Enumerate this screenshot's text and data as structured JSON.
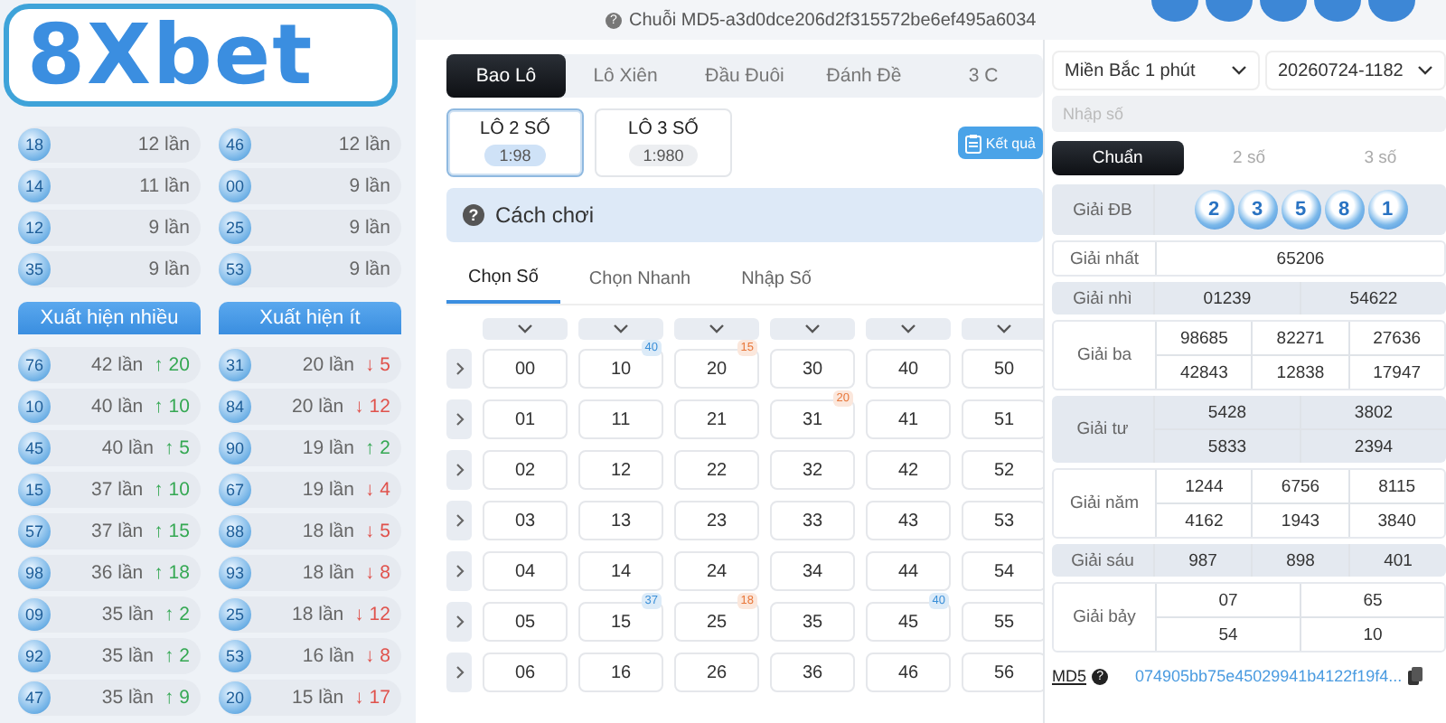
{
  "logo": {
    "text": "8Xbet"
  },
  "stats": {
    "columns": [
      {
        "rows": [
          {
            "ball": "18",
            "count": "12 lần"
          },
          {
            "ball": "14",
            "count": "11 lần"
          },
          {
            "ball": "12",
            "count": "9 lần"
          },
          {
            "ball": "35",
            "count": "9 lần"
          }
        ]
      },
      {
        "rows": [
          {
            "ball": "46",
            "count": "12 lần"
          },
          {
            "ball": "00",
            "count": "9 lần"
          },
          {
            "ball": "25",
            "count": "9 lần"
          },
          {
            "ball": "53",
            "count": "9 lần"
          }
        ]
      }
    ]
  },
  "frequency": [
    {
      "title": "Xuất hiện nhiều",
      "rows": [
        {
          "ball": "76",
          "count": "42 lần",
          "trend": "↑ 20",
          "rising": true
        },
        {
          "ball": "10",
          "count": "40 lần",
          "trend": "↑ 10",
          "rising": true
        },
        {
          "ball": "45",
          "count": "40 lần",
          "trend": "↑ 5",
          "rising": true
        },
        {
          "ball": "15",
          "count": "37 lần",
          "trend": "↑ 10",
          "rising": true
        },
        {
          "ball": "57",
          "count": "37 lần",
          "trend": "↑ 15",
          "rising": true
        },
        {
          "ball": "98",
          "count": "36 lần",
          "trend": "↑ 18",
          "rising": true
        },
        {
          "ball": "09",
          "count": "35 lần",
          "trend": "↑ 2",
          "rising": true
        },
        {
          "ball": "92",
          "count": "35 lần",
          "trend": "↑ 2",
          "rising": true
        },
        {
          "ball": "47",
          "count": "35 lần",
          "trend": "↑ 9",
          "rising": true
        }
      ]
    },
    {
      "title": "Xuất hiện ít",
      "rows": [
        {
          "ball": "31",
          "count": "20 lần",
          "trend": "↓ 5",
          "rising": false
        },
        {
          "ball": "84",
          "count": "20 lần",
          "trend": "↓ 12",
          "rising": false
        },
        {
          "ball": "90",
          "count": "19 lần",
          "trend": "↑ 2",
          "rising": true
        },
        {
          "ball": "67",
          "count": "19 lần",
          "trend": "↓ 4",
          "rising": false
        },
        {
          "ball": "88",
          "count": "18 lần",
          "trend": "↓ 5",
          "rising": false
        },
        {
          "ball": "93",
          "count": "18 lần",
          "trend": "↓ 8",
          "rising": false
        },
        {
          "ball": "25",
          "count": "18 lần",
          "trend": "↓ 12",
          "rising": false
        },
        {
          "ball": "53",
          "count": "16 lần",
          "trend": "↓ 8",
          "rising": false
        },
        {
          "ball": "20",
          "count": "15 lần",
          "trend": "↓ 17",
          "rising": false
        }
      ]
    }
  ],
  "md5_chain": {
    "help": "?",
    "text": "Chuỗi MD5-a3d0dce206d2f315572be6ef495a6034"
  },
  "game_tabs": [
    {
      "label": "Bao Lô",
      "selected": true
    },
    {
      "label": "Lô Xiên",
      "selected": false
    },
    {
      "label": "Đầu Đuôi",
      "selected": false
    },
    {
      "label": "Đánh Đề",
      "selected": false
    },
    {
      "label": "3 C",
      "selected": false
    }
  ],
  "bet_types": [
    {
      "name": "LÔ 2 SỐ",
      "odds": "1:98",
      "selected": true
    },
    {
      "name": "LÔ 3 SỐ",
      "odds": "1:980",
      "selected": false
    }
  ],
  "result_button": "Kết quả",
  "how_to_play": {
    "help": "?",
    "text": "Cách chơi"
  },
  "pick_tabs": [
    {
      "label": "Chọn Số",
      "selected": true
    },
    {
      "label": "Chọn Nhanh",
      "selected": false
    },
    {
      "label": "Nhập Số",
      "selected": false
    }
  ],
  "grid": {
    "rows": [
      {
        "cells": [
          {
            "number": "00"
          },
          {
            "number": "10",
            "badge": "40",
            "color": "#3a8fd8"
          },
          {
            "number": "20",
            "badge": "15",
            "color": "#e8773a"
          },
          {
            "number": "30"
          },
          {
            "number": "40"
          },
          {
            "number": "50"
          }
        ]
      },
      {
        "cells": [
          {
            "number": "01"
          },
          {
            "number": "11"
          },
          {
            "number": "21"
          },
          {
            "number": "31",
            "badge": "20",
            "color": "#e8773a"
          },
          {
            "number": "41"
          },
          {
            "number": "51"
          }
        ]
      },
      {
        "cells": [
          {
            "number": "02"
          },
          {
            "number": "12"
          },
          {
            "number": "22"
          },
          {
            "number": "32"
          },
          {
            "number": "42"
          },
          {
            "number": "52"
          }
        ]
      },
      {
        "cells": [
          {
            "number": "03"
          },
          {
            "number": "13"
          },
          {
            "number": "23"
          },
          {
            "number": "33"
          },
          {
            "number": "43"
          },
          {
            "number": "53"
          }
        ]
      },
      {
        "cells": [
          {
            "number": "04"
          },
          {
            "number": "14"
          },
          {
            "number": "24"
          },
          {
            "number": "34"
          },
          {
            "number": "44"
          },
          {
            "number": "54"
          }
        ]
      },
      {
        "cells": [
          {
            "number": "05"
          },
          {
            "number": "15",
            "badge": "37",
            "color": "#3a8fd8"
          },
          {
            "number": "25",
            "badge": "18",
            "color": "#e8773a"
          },
          {
            "number": "35"
          },
          {
            "number": "45",
            "badge": "40",
            "color": "#3a8fd8"
          },
          {
            "number": "55"
          }
        ]
      },
      {
        "cells": [
          {
            "number": "06"
          },
          {
            "number": "16"
          },
          {
            "number": "26"
          },
          {
            "number": "36"
          },
          {
            "number": "46"
          },
          {
            "number": "56"
          }
        ]
      }
    ]
  },
  "results": {
    "region": "Miền Bắc 1 phút",
    "draw": "20260724-1182",
    "search": {
      "placeholder": "Nhập số"
    },
    "modes": [
      {
        "label": "Chuẩn",
        "selected": true
      },
      {
        "label": "2 số",
        "selected": false
      },
      {
        "label": "3 số",
        "selected": false
      }
    ],
    "prizes": [
      {
        "label": "Giải ĐB",
        "kind": "balls",
        "lines": [
          [
            "2",
            "3",
            "5",
            "8",
            "1"
          ]
        ]
      },
      {
        "label": "Giải nhất",
        "kind": "grid",
        "lines": [
          [
            "65206"
          ]
        ]
      },
      {
        "label": "Giải nhì",
        "kind": "grid",
        "lines": [
          [
            "01239",
            "54622"
          ]
        ]
      },
      {
        "label": "Giải ba",
        "kind": "grid",
        "lines": [
          [
            "98685",
            "82271",
            "27636"
          ],
          [
            "42843",
            "12838",
            "17947"
          ]
        ]
      },
      {
        "label": "Giải tư",
        "kind": "grid",
        "lines": [
          [
            "5428",
            "3802"
          ],
          [
            "5833",
            "2394"
          ]
        ]
      },
      {
        "label": "Giải năm",
        "kind": "grid",
        "lines": [
          [
            "1244",
            "6756",
            "8115"
          ],
          [
            "4162",
            "1943",
            "3840"
          ]
        ]
      },
      {
        "label": "Giải sáu",
        "kind": "grid",
        "lines": [
          [
            "987",
            "898",
            "401"
          ]
        ]
      },
      {
        "label": "Giải bảy",
        "kind": "grid",
        "lines": [
          [
            "07",
            "65"
          ],
          [
            "54",
            "10"
          ]
        ]
      }
    ],
    "md5": {
      "label": "MD5",
      "help": "?",
      "value": "074905bb75e45029941b4122f19f4..."
    }
  }
}
